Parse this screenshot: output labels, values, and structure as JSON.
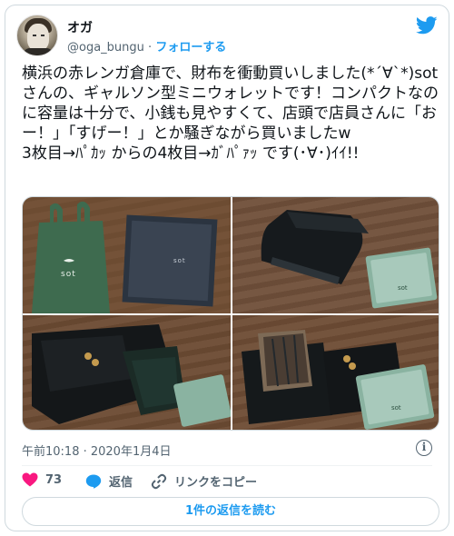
{
  "user": {
    "name": "オガ",
    "handle": "@oga_bungu",
    "separator": "·",
    "follow_label": "フォローする"
  },
  "tweet": {
    "text": "横浜の赤レンガ倉庫で、財布を衝動買いしました(*´∀`*)sotさんの、ギャルソン型ミニウォレットです！コンパクトなのに容量は十分で、小銭も見やすくて、店頭で店員さんに「おー！」「すげー！」とか騒ぎながら買いましたw\n3枚目→ﾊﾟｶｯ からの4枚目→ｶﾞﾊﾟｧｯ です(･∀･)ｲｲ!!",
    "photos": [
      {
        "brand_bag": "sot",
        "brand_box": "sot"
      },
      {
        "card": "sot"
      },
      {},
      {
        "card": "sot"
      }
    ]
  },
  "meta": {
    "timestamp": "午前10:18 · 2020年1月4日"
  },
  "actions": {
    "like_count": "73",
    "reply_label": "返信",
    "copy_link_label": "リンクをコピー",
    "read_replies_label": "1件の返信を読む"
  },
  "colors": {
    "accent": "#1d9bf0",
    "like": "#f91880",
    "secondary_text": "#536471"
  }
}
